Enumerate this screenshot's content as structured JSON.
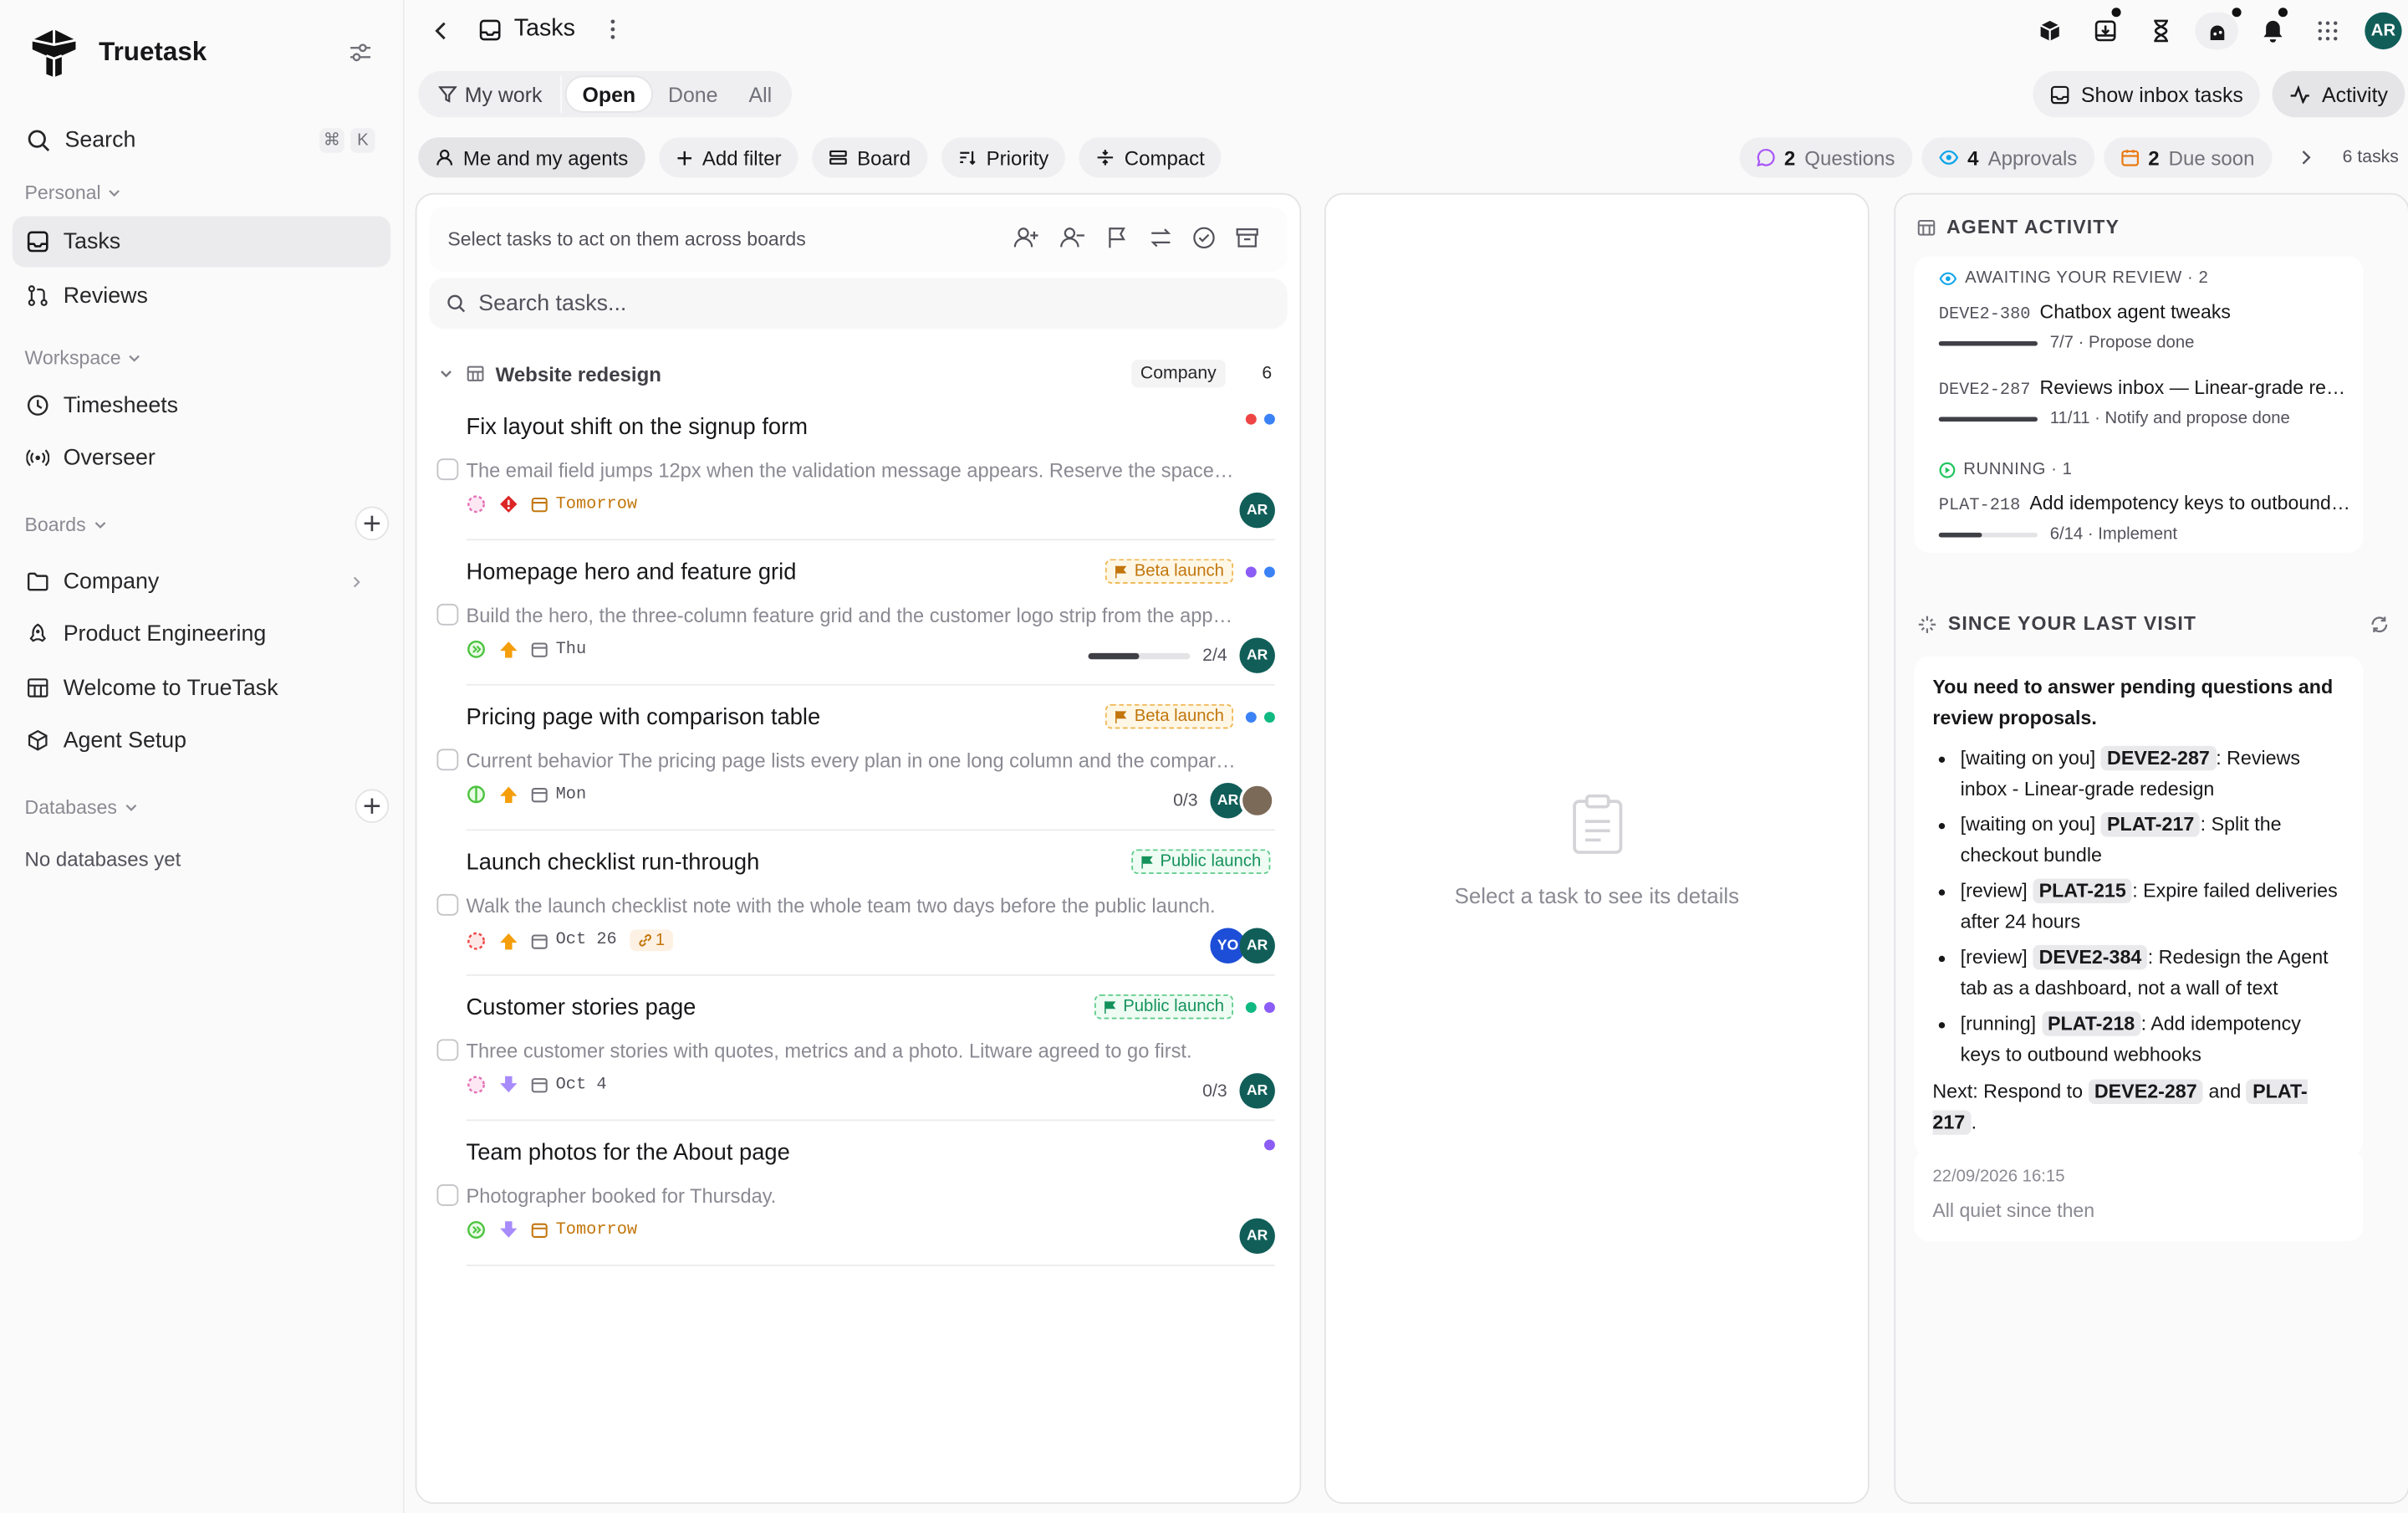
{
  "app": {
    "name": "Truetask"
  },
  "sidebar": {
    "search": {
      "label": "Search",
      "shortcut": [
        "⌘",
        "K"
      ]
    },
    "personal": {
      "title": "Personal",
      "items": [
        {
          "label": "Tasks"
        },
        {
          "label": "Reviews"
        }
      ]
    },
    "workspace": {
      "title": "Workspace",
      "items": [
        {
          "label": "Timesheets"
        },
        {
          "label": "Overseer"
        }
      ]
    },
    "boards": {
      "title": "Boards",
      "items": [
        {
          "label": "Company"
        },
        {
          "label": "Product Engineering"
        },
        {
          "label": "Welcome to TrueTask"
        },
        {
          "label": "Agent Setup"
        }
      ]
    },
    "databases": {
      "title": "Databases",
      "empty": "No databases yet"
    }
  },
  "topbar": {
    "title": "Tasks",
    "user_initials": "AR"
  },
  "view_tabs": {
    "my_work": "My work",
    "open": "Open",
    "done": "Done",
    "all": "All"
  },
  "actions": {
    "show_inbox": "Show inbox tasks",
    "activity": "Activity"
  },
  "filters": {
    "me_agents": "Me and my agents",
    "add_filter": "Add filter",
    "board": "Board",
    "priority": "Priority",
    "compact": "Compact"
  },
  "stats": {
    "questions": {
      "count": "2",
      "label": "Questions"
    },
    "approvals": {
      "count": "4",
      "label": "Approvals"
    },
    "due_soon": {
      "count": "2",
      "label": "Due soon"
    },
    "total": "6 tasks"
  },
  "task_list": {
    "bulk_hint": "Select tasks to act on them across boards",
    "search_placeholder": "Search tasks...",
    "group": {
      "name": "Website redesign",
      "tag": "Company",
      "count": "6"
    },
    "tasks": [
      {
        "title": "Fix layout shift on the signup form",
        "desc": "The email field jumps 12px when the validation message appears. Reserve the space so the layout stays put.",
        "due": "Tomorrow",
        "assignees": [
          "AR"
        ]
      },
      {
        "title": "Homepage hero and feature grid",
        "desc": "Build the hero, the three-column feature grid and the customer logo strip from the approved designs.",
        "due": "Thu",
        "tag": "Beta launch",
        "progress_text": "2/4",
        "progress": 0.5,
        "assignees": [
          "AR"
        ]
      },
      {
        "title": "Pricing page with comparison table",
        "desc": "Current behavior The pricing page lists every plan in one long column and the comparison is hard to read.",
        "due": "Mon",
        "tag": "Beta launch",
        "progress_text": "0/3",
        "assignees": [
          "AR"
        ]
      },
      {
        "title": "Launch checklist run-through",
        "desc": "Walk the launch checklist note with the whole team two days before the public launch.",
        "due": "Oct 26",
        "tag": "Public launch",
        "links": "1",
        "assignees": [
          "YO",
          "AR"
        ]
      },
      {
        "title": "Customer stories page",
        "desc": "Three customer stories with quotes, metrics and a photo. Litware agreed to go first.",
        "due": "Oct 4",
        "tag": "Public launch",
        "progress_text": "0/3",
        "assignees": [
          "AR"
        ]
      },
      {
        "title": "Team photos for the About page",
        "desc": "Photographer booked for Thursday.",
        "due": "Tomorrow",
        "assignees": [
          "AR"
        ]
      }
    ]
  },
  "detail": {
    "empty": "Select a task to see its details"
  },
  "activity": {
    "title": "AGENT ACTIVITY",
    "awaiting": {
      "label": "AWAITING YOUR REVIEW · 2",
      "items": [
        {
          "id": "DEVE2-380",
          "title": "Chatbox agent tweaks",
          "step": "7/7 · Propose done",
          "progress": 1
        },
        {
          "id": "DEVE2-287",
          "title": "Reviews inbox — Linear-grade redesign",
          "step": "11/11 · Notify and propose done",
          "progress": 1
        }
      ]
    },
    "running": {
      "label": "RUNNING · 1",
      "items": [
        {
          "id": "PLAT-218",
          "title": "Add idempotency keys to outbound webhooks",
          "step": "6/14 · Implement",
          "progress": 0.43
        }
      ]
    },
    "since": {
      "title": "SINCE YOUR LAST VISIT",
      "lead": "You need to answer pending questions and review proposals.",
      "items": [
        {
          "prefix": "[waiting on you]",
          "code": "DEVE2-287",
          "text": ": Reviews inbox - Linear-grade redesign"
        },
        {
          "prefix": "[waiting on you]",
          "code": "PLAT-217",
          "text": ": Split the checkout bundle"
        },
        {
          "prefix": "[review]",
          "code": "PLAT-215",
          "text": ": Expire failed deliveries after 24 hours"
        },
        {
          "prefix": "[review]",
          "code": "DEVE2-384",
          "text": ": Redesign the Agent tab as a dashboard, not a wall of text"
        },
        {
          "prefix": "[running]",
          "code": "PLAT-218",
          "text": ": Add idempotency keys to outbound webhooks"
        }
      ],
      "next": {
        "prefix": "Next: Respond to",
        "code1": "DEVE2-287",
        "and": "and",
        "code2": "PLAT-217",
        "end": "."
      }
    },
    "quiet": {
      "timestamp": "22/09/2026 16:15",
      "text": "All quiet since then"
    }
  },
  "colors": {
    "accent_teal": "#115e59",
    "warning": "#c2760c",
    "success": "#15925b",
    "danger": "#dc2626"
  }
}
